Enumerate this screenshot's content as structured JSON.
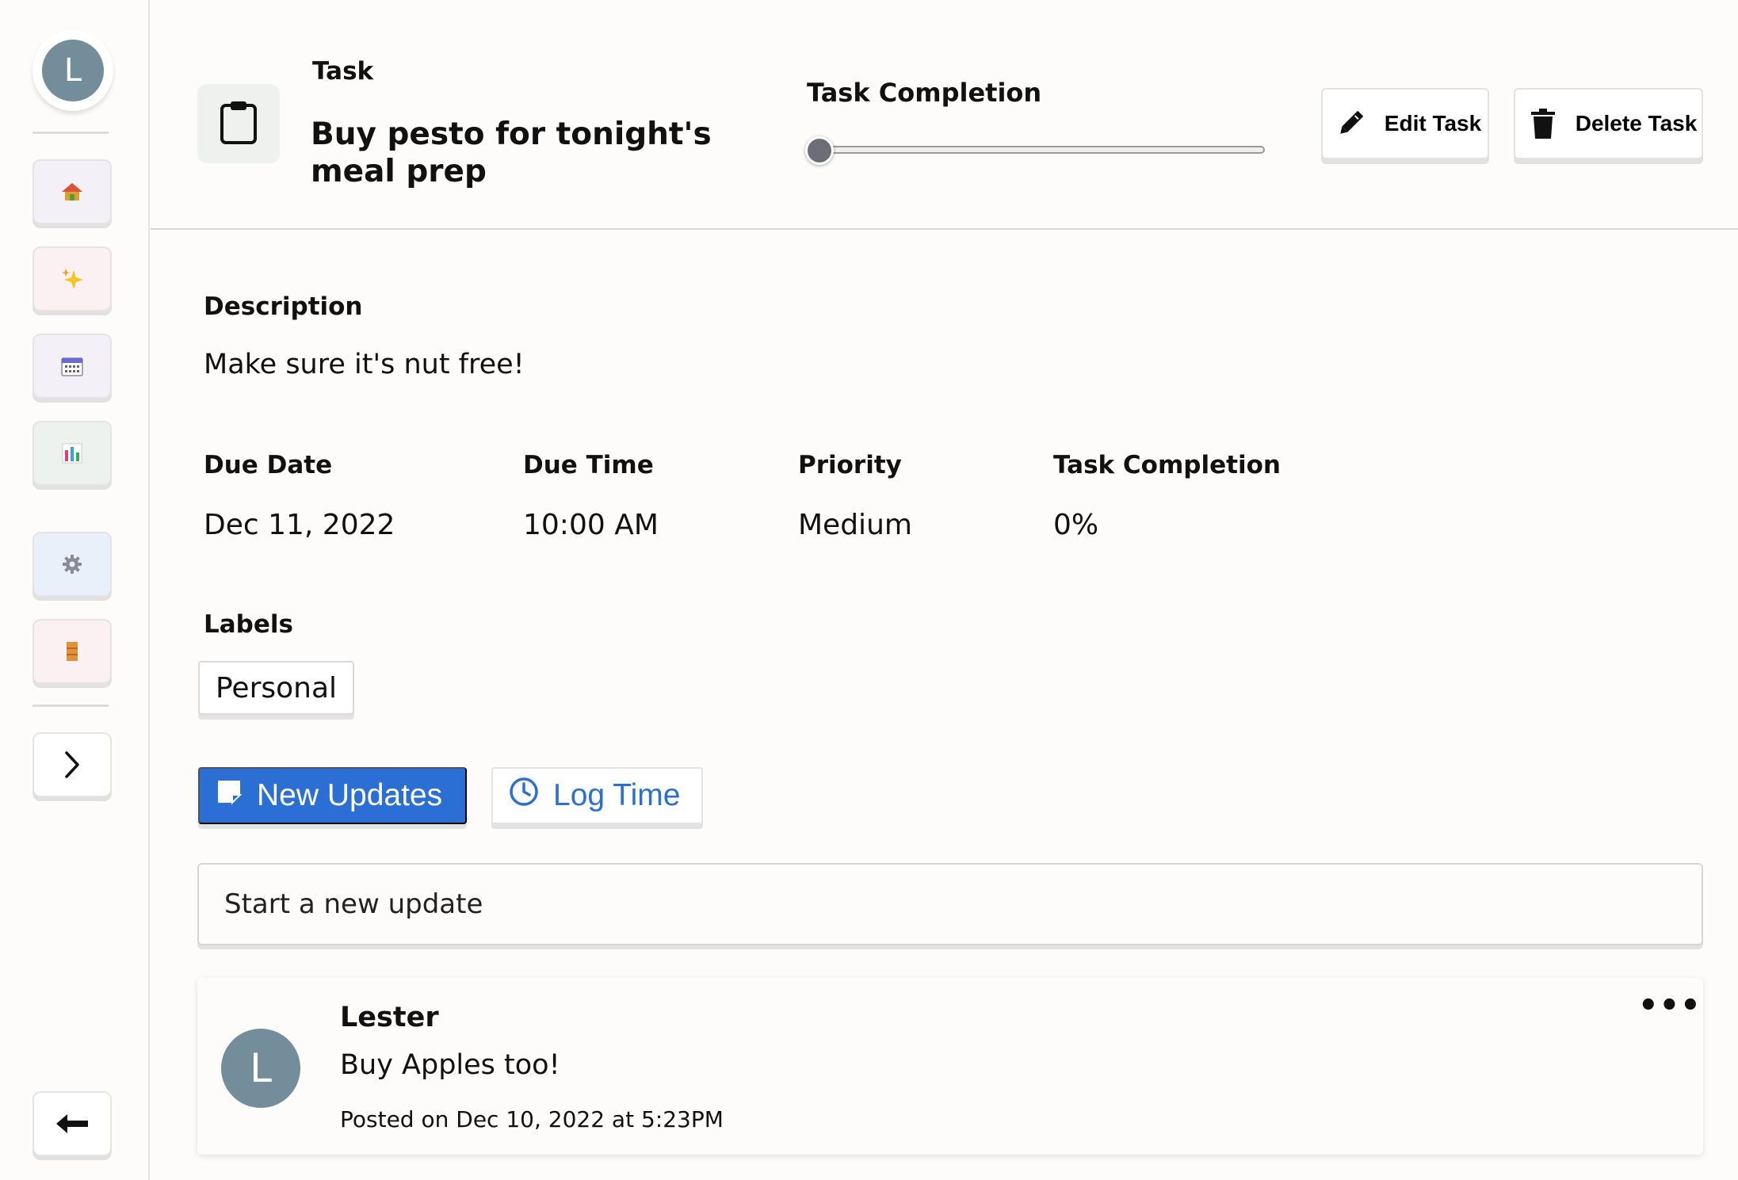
{
  "sidebar": {
    "avatar_initial": "L",
    "nav": [
      {
        "name": "home",
        "icon": "house-icon",
        "bg": "#f3f1f7"
      },
      {
        "name": "sparkles",
        "icon": "sparkles-icon",
        "bg": "#fbf0f2"
      },
      {
        "name": "calendar",
        "icon": "calendar-icon",
        "bg": "#f3f1f7"
      },
      {
        "name": "stats",
        "icon": "bar-chart-icon",
        "bg": "#eef2ee"
      },
      {
        "name": "settings",
        "icon": "gear-icon",
        "bg": "#e8f1fa"
      },
      {
        "name": "notes",
        "icon": "notebook-icon",
        "bg": "#fbf0f2"
      }
    ],
    "expand_icon": "chevron-right-icon",
    "back_icon": "arrow-left-icon"
  },
  "header": {
    "kicker": "Task",
    "title": "Buy pesto for tonight's meal prep",
    "completion_label": "Task Completion",
    "completion_value": 0,
    "edit_label": "Edit Task",
    "delete_label": "Delete Task"
  },
  "details": {
    "description_label": "Description",
    "description": "Make sure it's nut free!",
    "fields": [
      {
        "label": "Due Date",
        "value": "Dec 11, 2022"
      },
      {
        "label": "Due Time",
        "value": "10:00 AM"
      },
      {
        "label": "Priority",
        "value": "Medium"
      },
      {
        "label": "Task Completion",
        "value": "0%"
      }
    ],
    "labels_heading": "Labels",
    "labels": [
      "Personal"
    ]
  },
  "tabs": {
    "new_updates": "New Updates",
    "log_time": "Log Time"
  },
  "update_input": {
    "placeholder": "Start a new update"
  },
  "updates": [
    {
      "avatar_initial": "L",
      "author": "Lester",
      "body": "Buy Apples too!",
      "meta": "Posted on Dec 10, 2022 at 5:23PM",
      "menu": "•••"
    }
  ],
  "colors": {
    "primary": "#2c6fd4",
    "avatar": "#748d9a"
  }
}
